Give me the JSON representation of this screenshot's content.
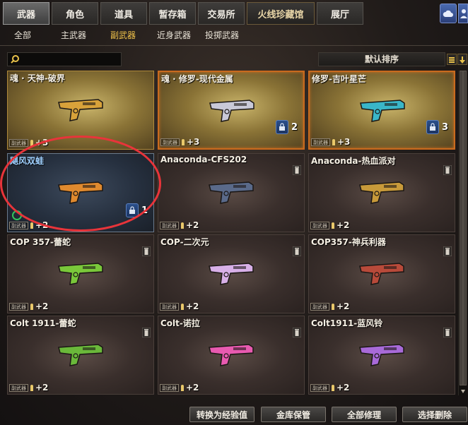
{
  "top_tabs": [
    "武器",
    "角色",
    "道具",
    "暂存箱",
    "交易所",
    "火线珍藏馆",
    "展厅"
  ],
  "sub_tabs": [
    "全部",
    "主武器",
    "副武器",
    "近身武器",
    "投掷武器"
  ],
  "search": {
    "placeholder": "",
    "value": ""
  },
  "sort": {
    "label": "默认排序"
  },
  "items": [
    {
      "name": "魂 · 天神-破界",
      "tag": "副武器",
      "level": "+3",
      "count": "",
      "style": "gold",
      "gun_color": "#d8a23a"
    },
    {
      "name": "魂 · 修罗-现代金属",
      "tag": "副武器",
      "level": "+3",
      "count": "2",
      "style": "gold-glow",
      "gun_color": "#c9c9d8"
    },
    {
      "name": "修罗-吉叶星芒",
      "tag": "副武器",
      "level": "+3",
      "count": "3",
      "style": "gold-glow",
      "gun_color": "#3ab6c8"
    },
    {
      "name": "飓风双蛙",
      "tag": "副武器",
      "level": "+2",
      "count": "1",
      "style": "blue",
      "gun_color": "#e08a2e"
    },
    {
      "name": "Anaconda-CFS202",
      "tag": "副武器",
      "level": "+2",
      "count": "",
      "style": "plain",
      "gun_color": "#5a6a8a"
    },
    {
      "name": "Anaconda-热血派对",
      "tag": "副武器",
      "level": "+2",
      "count": "",
      "style": "plain",
      "gun_color": "#c89a3a"
    },
    {
      "name": "COP 357-蕾蛇",
      "tag": "副武器",
      "level": "+2",
      "count": "",
      "style": "plain",
      "gun_color": "#7ac83a"
    },
    {
      "name": "COP-二次元",
      "tag": "副武器",
      "level": "+2",
      "count": "",
      "style": "plain",
      "gun_color": "#d8b0e8"
    },
    {
      "name": "COP357-神兵利器",
      "tag": "副武器",
      "level": "+2",
      "count": "",
      "style": "plain",
      "gun_color": "#b84a3a"
    },
    {
      "name": "Colt 1911-蕾蛇",
      "tag": "副武器",
      "level": "+2",
      "count": "",
      "style": "plain",
      "gun_color": "#6ab83a"
    },
    {
      "name": "Colt-诺拉",
      "tag": "副武器",
      "level": "+2",
      "count": "",
      "style": "plain",
      "gun_color": "#e85ab0"
    },
    {
      "name": "Colt1911-蓝风铃",
      "tag": "副武器",
      "level": "+2",
      "count": "",
      "style": "plain",
      "gun_color": "#a86ad8"
    }
  ],
  "bottom_buttons": [
    "转换为经验值",
    "金库保管",
    "全部修理",
    "选择删除"
  ],
  "colors": {
    "active_subtab": "#f1c34a",
    "highlight_ring": "#e8343a"
  }
}
